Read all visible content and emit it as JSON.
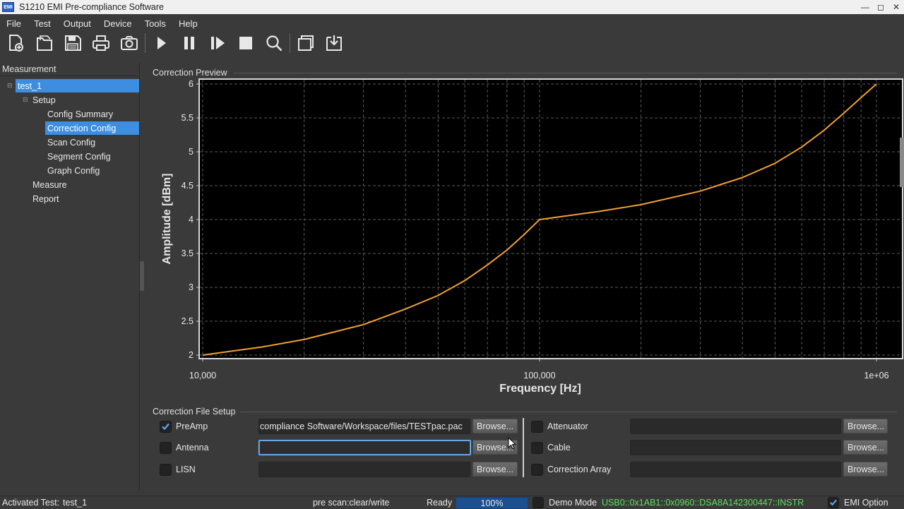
{
  "window": {
    "app_icon_text": "EMI",
    "title": "S1210 EMI Pre-compliance Software"
  },
  "menu": {
    "items": [
      "File",
      "Test",
      "Output",
      "Device",
      "Tools",
      "Help"
    ]
  },
  "toolbar": {
    "buttons": [
      "new-file-icon",
      "open-folder-icon",
      "save-icon",
      "print-icon",
      "camera-icon",
      "play-icon",
      "pause-icon",
      "step-icon",
      "stop-icon",
      "search-icon",
      "window-icon",
      "export-icon"
    ]
  },
  "tree": {
    "header": "Measurement",
    "root": "test_1",
    "setup": "Setup",
    "setup_children": [
      "Config Summary",
      "Correction Config",
      "Scan Config",
      "Segment Config",
      "Graph Config"
    ],
    "measure": "Measure",
    "report": "Report"
  },
  "preview": {
    "label": "Correction Preview"
  },
  "chart_data": {
    "type": "line",
    "title": "",
    "xlabel": "Frequency [Hz]",
    "ylabel": "Amplitude [dBm]",
    "x_scale": "log",
    "xlim": [
      10000,
      1000000
    ],
    "ylim": [
      2,
      6
    ],
    "x_ticks": [
      "10,000",
      "100,000",
      "1e+06"
    ],
    "y_ticks": [
      "2",
      "2.5",
      "3",
      "3.5",
      "4",
      "4.5",
      "5",
      "5.5",
      "6"
    ],
    "grid": true,
    "line_color": "#f0a030",
    "background": "#000000",
    "series": [
      {
        "x": [
          10000,
          15000,
          20000,
          30000,
          40000,
          50000,
          60000,
          70000,
          80000,
          90000,
          100000,
          150000,
          200000,
          300000,
          400000,
          500000,
          600000,
          700000,
          800000,
          900000,
          1000000
        ],
        "y": [
          2.0,
          2.12,
          2.23,
          2.45,
          2.68,
          2.88,
          3.1,
          3.33,
          3.55,
          3.78,
          4.0,
          4.12,
          4.22,
          4.42,
          4.62,
          4.83,
          5.07,
          5.32,
          5.57,
          5.8,
          6.0
        ]
      }
    ]
  },
  "correction_setup": {
    "label": "Correction File Setup",
    "browse_label": "Browse...",
    "left": [
      {
        "name": "PreAmp",
        "checked": true,
        "path": "compliance Software/Workspace/files/TESTpac.pac"
      },
      {
        "name": "Antenna",
        "checked": false,
        "path": ""
      },
      {
        "name": "LISN",
        "checked": false,
        "path": ""
      }
    ],
    "right": [
      {
        "name": "Attenuator",
        "checked": false,
        "path": ""
      },
      {
        "name": "Cable",
        "checked": false,
        "path": ""
      },
      {
        "name": "Correction Array",
        "checked": false,
        "path": ""
      }
    ]
  },
  "status": {
    "activated_label": "Activated Test:",
    "activated_value": "test_1",
    "scan_mode": "pre scan:clear/write",
    "state": "Ready",
    "progress": "100%",
    "demo_label": "Demo Mode",
    "device": "USB0::0x1AB1::0x0960::DSA8A142300447::INSTR",
    "emi_option": "EMI Option"
  },
  "colors": {
    "selection": "#3d8ee0",
    "device_text": "#5fe05f",
    "checkmark": "#5aa9ff"
  }
}
